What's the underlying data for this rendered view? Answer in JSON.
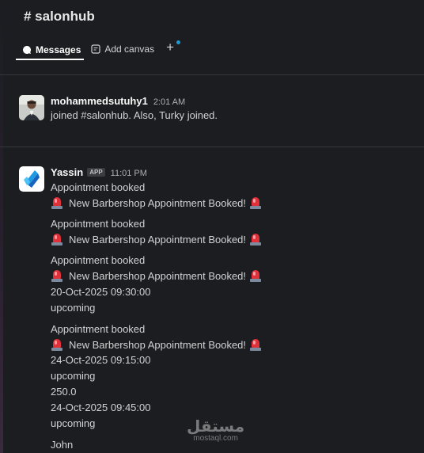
{
  "channel": {
    "title": "# salonhub"
  },
  "tabs": [
    {
      "label": "Messages",
      "active": true
    },
    {
      "label": "Add canvas",
      "active": false
    }
  ],
  "messages": [
    {
      "author": "mohammedsutuhy1",
      "time": "2:01 AM",
      "text": "joined #salonhub. Also, Turky joined."
    },
    {
      "author": "Yassin",
      "badge": "APP",
      "time": "11:01 PM",
      "lines": [
        "Appointment booked",
        "New Barbershop Appointment Booked!",
        "Appointment booked",
        "New Barbershop Appointment Booked!",
        "Appointment booked",
        "New Barbershop Appointment Booked!",
        "20-Oct-2025 09:30:00",
        "upcoming",
        "Appointment booked",
        "New Barbershop Appointment Booked!",
        "24-Oct-2025 09:15:00",
        "upcoming",
        "250.0",
        "24-Oct-2025 09:45:00",
        "upcoming",
        "John"
      ]
    }
  ],
  "icons": {
    "siren": "rotating-light-icon",
    "messages": "chat-bubble-icon",
    "canvas": "canvas-icon",
    "add": "plus-icon"
  },
  "colors": {
    "background": "#1b1d21",
    "accent_dot": "#1d9bd1",
    "siren_red": "#e0303a"
  },
  "watermark": {
    "main": "مستقل",
    "sub": "mostaql.com"
  }
}
